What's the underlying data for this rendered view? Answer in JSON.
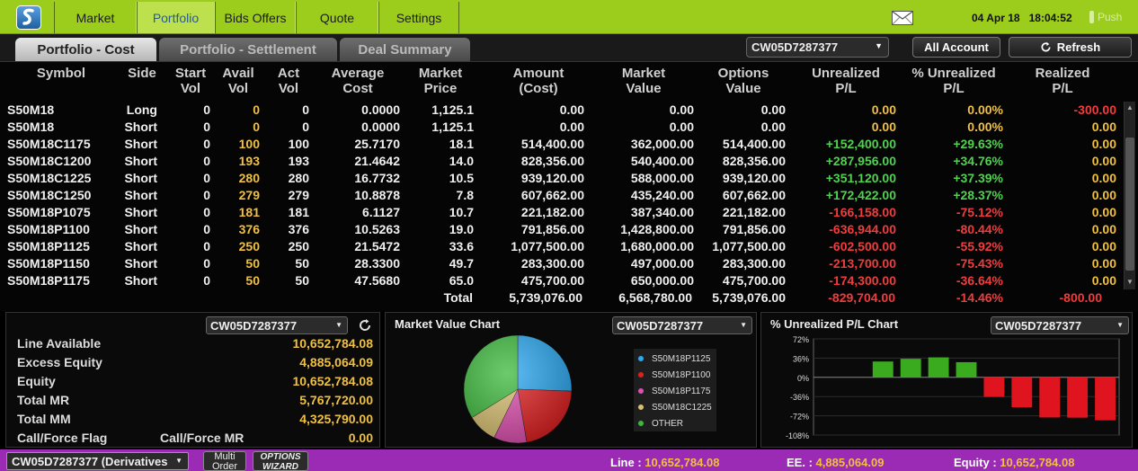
{
  "nav": {
    "tabs": [
      "Market",
      "Portfolio",
      "Bids Offers",
      "Quote",
      "Settings"
    ],
    "active_tab": "Portfolio",
    "date": "04 Apr 18",
    "time": "18:04:52",
    "push_label": "Push"
  },
  "subtabs": [
    "Portfolio - Cost",
    "Portfolio - Settlement",
    "Deal Summary"
  ],
  "account_select": "CW05D7287377",
  "all_account_label": "All Account",
  "refresh_label": "Refresh",
  "table": {
    "headers": [
      [
        "Symbol"
      ],
      [
        "Side"
      ],
      [
        "Start",
        "Vol"
      ],
      [
        "Avail",
        "Vol"
      ],
      [
        "Act",
        "Vol"
      ],
      [
        "Average",
        "Cost"
      ],
      [
        "Market",
        "Price"
      ],
      [
        "Amount",
        "(Cost)"
      ],
      [
        "Market",
        "Value"
      ],
      [
        "Options",
        "Value"
      ],
      [
        "Unrealized",
        "P/L"
      ],
      [
        "% Unrealized",
        "P/L"
      ],
      [
        "Realized",
        "P/L"
      ]
    ],
    "rows": [
      [
        "S50M18",
        "Long",
        "0",
        "0",
        "0",
        "0.0000",
        "1,125.1",
        "0.00",
        "0.00",
        "0.00",
        "0.00",
        "0.00%",
        "-300.00"
      ],
      [
        "S50M18",
        "Short",
        "0",
        "0",
        "0",
        "0.0000",
        "1,125.1",
        "0.00",
        "0.00",
        "0.00",
        "0.00",
        "0.00%",
        "0.00"
      ],
      [
        "S50M18C1175",
        "Short",
        "0",
        "100",
        "100",
        "25.7170",
        "18.1",
        "514,400.00",
        "362,000.00",
        "514,400.00",
        "+152,400.00",
        "+29.63%",
        "0.00"
      ],
      [
        "S50M18C1200",
        "Short",
        "0",
        "193",
        "193",
        "21.4642",
        "14.0",
        "828,356.00",
        "540,400.00",
        "828,356.00",
        "+287,956.00",
        "+34.76%",
        "0.00"
      ],
      [
        "S50M18C1225",
        "Short",
        "0",
        "280",
        "280",
        "16.7732",
        "10.5",
        "939,120.00",
        "588,000.00",
        "939,120.00",
        "+351,120.00",
        "+37.39%",
        "0.00"
      ],
      [
        "S50M18C1250",
        "Short",
        "0",
        "279",
        "279",
        "10.8878",
        "7.8",
        "607,662.00",
        "435,240.00",
        "607,662.00",
        "+172,422.00",
        "+28.37%",
        "0.00"
      ],
      [
        "S50M18P1075",
        "Short",
        "0",
        "181",
        "181",
        "6.1127",
        "10.7",
        "221,182.00",
        "387,340.00",
        "221,182.00",
        "-166,158.00",
        "-75.12%",
        "0.00"
      ],
      [
        "S50M18P1100",
        "Short",
        "0",
        "376",
        "376",
        "10.5263",
        "19.0",
        "791,856.00",
        "1,428,800.00",
        "791,856.00",
        "-636,944.00",
        "-80.44%",
        "0.00"
      ],
      [
        "S50M18P1125",
        "Short",
        "0",
        "250",
        "250",
        "21.5472",
        "33.6",
        "1,077,500.00",
        "1,680,000.00",
        "1,077,500.00",
        "-602,500.00",
        "-55.92%",
        "0.00"
      ],
      [
        "S50M18P1150",
        "Short",
        "0",
        "50",
        "50",
        "28.3300",
        "49.7",
        "283,300.00",
        "497,000.00",
        "283,300.00",
        "-213,700.00",
        "-75.43%",
        "0.00"
      ],
      [
        "S50M18P1175",
        "Short",
        "0",
        "50",
        "50",
        "47.5680",
        "65.0",
        "475,700.00",
        "650,000.00",
        "475,700.00",
        "-174,300.00",
        "-36.64%",
        "0.00"
      ]
    ],
    "total": {
      "label": "Total",
      "amount_cost": "5,739,076.00",
      "market_value": "6,568,780.00",
      "options_value": "5,739,076.00",
      "unrealized": "-829,704.00",
      "pct_unrealized": "-14.46%",
      "realized": "-800.00"
    }
  },
  "account_panel": {
    "select": "CW05D7287377",
    "rows": [
      {
        "label": "Line Available",
        "value": "10,652,784.08"
      },
      {
        "label": "Excess Equity",
        "value": "4,885,064.09"
      },
      {
        "label": "Equity",
        "value": "10,652,784.08"
      },
      {
        "label": "Total MR",
        "value": "5,767,720.00"
      },
      {
        "label": "Total MM",
        "value": "4,325,790.00"
      },
      {
        "label": "Call/Force Flag",
        "label2": "Call/Force MR",
        "value": "0.00"
      }
    ]
  },
  "market_value_chart": {
    "title": "Market Value Chart",
    "select": "CW05D7287377",
    "legend": [
      {
        "name": "S50M18P1125",
        "color": "#2aa8f0"
      },
      {
        "name": "S50M18P1100",
        "color": "#e02020"
      },
      {
        "name": "S50M18P1175",
        "color": "#e050b0"
      },
      {
        "name": "S50M18C1225",
        "color": "#d8c070"
      },
      {
        "name": "OTHER",
        "color": "#3cb83c"
      }
    ]
  },
  "unrealized_chart": {
    "title": "% Unrealized P/L Chart",
    "select": "CW05D7287377",
    "ticks": [
      "72%",
      "36%",
      "0%",
      "-36%",
      "-72%",
      "-108%"
    ]
  },
  "chart_data": [
    {
      "type": "pie",
      "title": "Market Value Chart",
      "labels": [
        "S50M18P1125",
        "S50M18P1100",
        "S50M18P1175",
        "S50M18C1225",
        "OTHER"
      ],
      "values": [
        1680000,
        1428800,
        650000,
        588000,
        2221980
      ],
      "colors": [
        "#2aa8f0",
        "#e02020",
        "#e050b0",
        "#d8c070",
        "#3cb83c"
      ]
    },
    {
      "type": "bar",
      "title": "% Unrealized P/L Chart",
      "categories": [
        "",
        "",
        "",
        "",
        "",
        "",
        "",
        "",
        "",
        "",
        ""
      ],
      "values": [
        0,
        0,
        29.63,
        34.76,
        37.39,
        28.37,
        -36.64,
        -55.92,
        -75.12,
        -75.43,
        -80.44
      ],
      "ylim": [
        -108,
        72
      ],
      "yticks": [
        72,
        36,
        0,
        -36,
        -72,
        -108
      ]
    }
  ],
  "status": {
    "account": "CW05D7287377 (Derivatives",
    "multi_order": "Multi Order",
    "options_wizard": "OPTIONS WIZARD",
    "line_label": "Line :",
    "line_value": "10,652,784.08",
    "ee_label": "EE. :",
    "ee_value": "4,885,064.09",
    "equity_label": "Equity :",
    "equity_value": "10,652,784.08"
  }
}
